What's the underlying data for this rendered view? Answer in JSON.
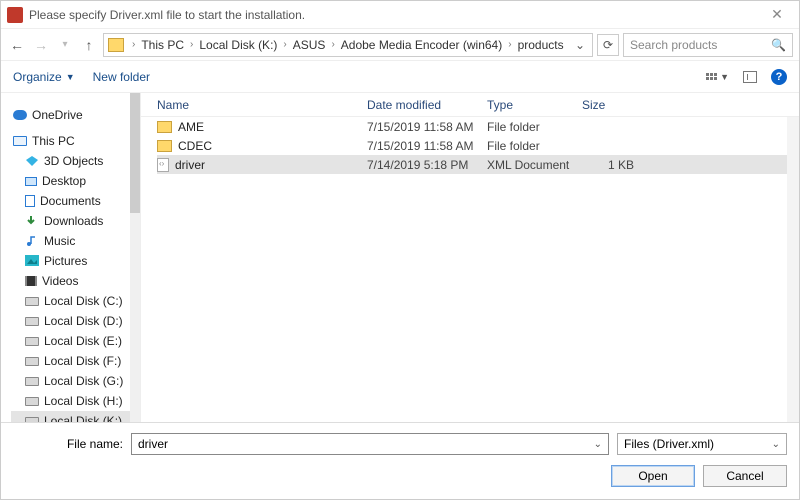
{
  "title": "Please specify Driver.xml file to start the installation.",
  "breadcrumb": [
    "This PC",
    "Local Disk (K:)",
    "ASUS",
    "Adobe Media Encoder (win64)",
    "products"
  ],
  "search_placeholder": "Search products",
  "toolbar": {
    "organize": "Organize",
    "newfolder": "New folder"
  },
  "columns": {
    "name": "Name",
    "date": "Date modified",
    "type": "Type",
    "size": "Size"
  },
  "nav": {
    "onedrive": "OneDrive",
    "thispc": "This PC",
    "items": [
      "3D Objects",
      "Desktop",
      "Documents",
      "Downloads",
      "Music",
      "Pictures",
      "Videos",
      "Local Disk (C:)",
      "Local Disk (D:)",
      "Local Disk (E:)",
      "Local Disk (F:)",
      "Local Disk (G:)",
      "Local Disk (H:)",
      "Local Disk (K:)"
    ]
  },
  "files": [
    {
      "name": "AME",
      "date": "7/15/2019 11:58 AM",
      "type": "File folder",
      "size": "",
      "icon": "folder"
    },
    {
      "name": "CDEC",
      "date": "7/15/2019 11:58 AM",
      "type": "File folder",
      "size": "",
      "icon": "folder"
    },
    {
      "name": "driver",
      "date": "7/14/2019 5:18 PM",
      "type": "XML Document",
      "size": "1 KB",
      "icon": "xml",
      "selected": true
    }
  ],
  "footer": {
    "filename_label": "File name:",
    "filename_value": "driver",
    "filter": "Files (Driver.xml)",
    "open": "Open",
    "cancel": "Cancel"
  }
}
